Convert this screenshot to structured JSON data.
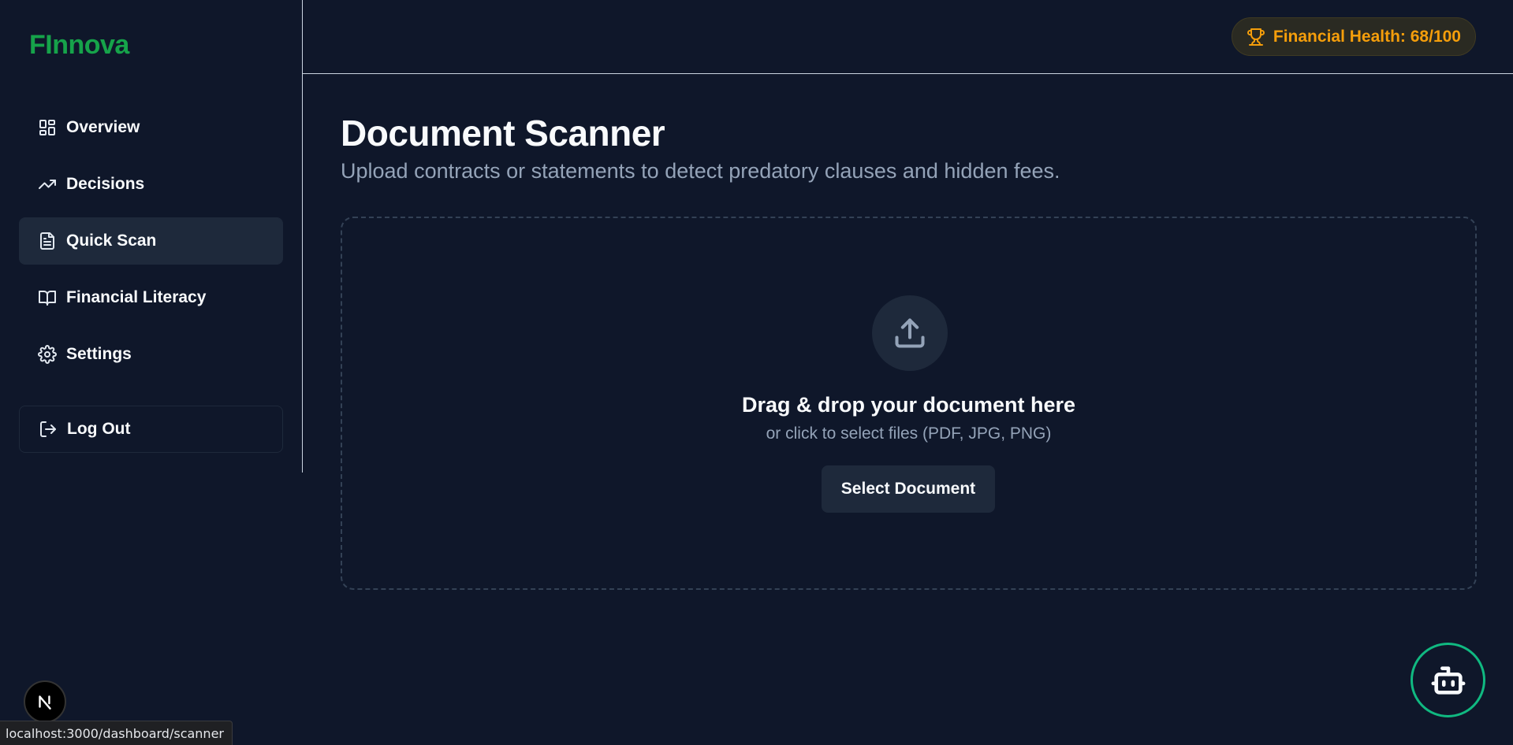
{
  "brand": {
    "name": "FInnova",
    "color": "#16a34a"
  },
  "sidebar": {
    "items": [
      {
        "label": "Overview",
        "icon": "layout-dashboard-icon"
      },
      {
        "label": "Decisions",
        "icon": "trending-up-icon"
      },
      {
        "label": "Quick Scan",
        "icon": "file-text-icon",
        "active": true
      },
      {
        "label": "Financial Literacy",
        "icon": "book-open-icon"
      },
      {
        "label": "Settings",
        "icon": "gear-icon"
      }
    ],
    "logout_label": "Log Out"
  },
  "header": {
    "health_badge": "Financial Health: 68/100",
    "badge_icon": "trophy-icon",
    "badge_color": "#f59e0b"
  },
  "main": {
    "title": "Document Scanner",
    "subtitle": "Upload contracts or statements to detect predatory clauses and hidden fees.",
    "dropzone": {
      "icon": "upload-icon",
      "title": "Drag & drop your document here",
      "subtitle": "or click to select files (PDF, JPG, PNG)",
      "button_label": "Select Document"
    }
  },
  "floating": {
    "bot_icon": "bot-icon",
    "bot_border_color": "#10b981",
    "dev_indicator_icon": "nextjs-icon"
  },
  "status_bar": {
    "url": "localhost:3000/dashboard/scanner"
  }
}
